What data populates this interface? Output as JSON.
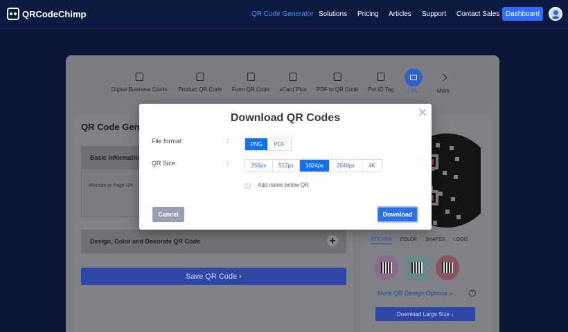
{
  "brand": {
    "name": "QRCodeChimp"
  },
  "nav": {
    "items": [
      {
        "label": "QR Code Generator",
        "active": true
      },
      {
        "label": "Solutions"
      },
      {
        "label": "Pricing"
      },
      {
        "label": "Articles"
      },
      {
        "label": "Support"
      },
      {
        "label": "Contact Sales"
      }
    ],
    "dashboard_label": "Dashboard"
  },
  "qr_types": [
    {
      "label": "Digital Business Cards",
      "icon": "card-icon"
    },
    {
      "label": "Product QR Code",
      "icon": "product-icon"
    },
    {
      "label": "Form QR Code",
      "icon": "form-icon"
    },
    {
      "label": "vCard Plus",
      "icon": "vcard-icon"
    },
    {
      "label": "PDF to QR Code",
      "icon": "pdf-icon"
    },
    {
      "label": "Pet ID Tag",
      "icon": "paw-icon"
    },
    {
      "label": "URL",
      "icon": "url-icon",
      "active": true
    },
    {
      "label": "More",
      "icon": "chevron-right-icon"
    }
  ],
  "left_panel": {
    "title": "QR Code Gene",
    "basic_info": "Basic Information",
    "url_placeholder": "Website or Page UR",
    "design_section": "Design, Color and Decorate QR Code",
    "save_label": "Save QR Code ›"
  },
  "right_panel": {
    "design_tabs": [
      "STICKER",
      "COLOR",
      "SHAPES",
      "LOGO"
    ],
    "more_options": "More QR Design Options ››",
    "download_large": "Download Large Size ↓"
  },
  "modal": {
    "title": "Download QR Codes",
    "file_format_label": "File format",
    "colon": ":",
    "formats": [
      {
        "label": "PNG",
        "active": true
      },
      {
        "label": "PDF"
      }
    ],
    "qr_size_label": "QR Size",
    "sizes": [
      {
        "label": "256px"
      },
      {
        "label": "512px"
      },
      {
        "label": "1024px",
        "active": true
      },
      {
        "label": "2048px"
      },
      {
        "label": "4K"
      }
    ],
    "add_name_label": "Add name below QR",
    "add_name_checked": false,
    "cancel_label": "Cancel",
    "download_label": "Download"
  },
  "colors": {
    "accent": "#1570ef",
    "page_bg": "#0b1638",
    "nav_active": "#4c8dff",
    "dashboard_btn": "#2f6dff"
  }
}
